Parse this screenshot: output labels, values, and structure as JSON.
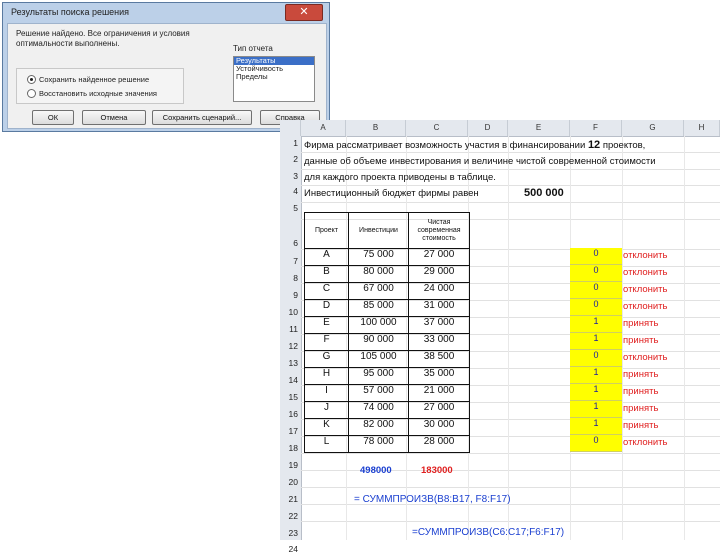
{
  "dialog": {
    "title": "Результаты поиска решения",
    "close_label": "✕",
    "message_line1": "Решение найдено. Все ограничения и условия",
    "message_line2": "оптимальности выполнены.",
    "reports_label": "Тип отчета",
    "reports": [
      "Результаты",
      "Устойчивость",
      "Пределы"
    ],
    "option_keep": "Сохранить найденное решение",
    "option_restore": "Восстановить исходные значения",
    "btn_ok": "ОК",
    "btn_cancel": "Отмена",
    "btn_save_scenario": "Сохранить сценарий...",
    "btn_help": "Справка"
  },
  "sheet": {
    "columns": [
      "A",
      "B",
      "C",
      "D",
      "E",
      "F",
      "G",
      "H"
    ],
    "rows": [
      "1",
      "2",
      "3",
      "4",
      "5",
      "6",
      "7",
      "8",
      "9",
      "10",
      "11",
      "12",
      "13",
      "14",
      "15",
      "16",
      "17",
      "18",
      "19",
      "20",
      "21",
      "22",
      "23",
      "24"
    ],
    "line1": "Фирма рассматривает возможность участия в финансировании",
    "line1_bold": "12",
    "line1_end": "проектов,",
    "line2": "данные об объеме инвестирования и величине чистой современной стоимости",
    "line3": "для каждого проекта приводены в таблице.",
    "budget_label": "Инвестиционный бюджет фирмы равен",
    "budget_value": "500 000",
    "table_headers": [
      "Проект",
      "Инвестиции",
      "Чистая современная стоимость"
    ],
    "projects": [
      {
        "name": "A",
        "invest": "75 000",
        "npv": "27 000",
        "x": "0",
        "decision": "отклонить"
      },
      {
        "name": "B",
        "invest": "80 000",
        "npv": "29 000",
        "x": "0",
        "decision": "отклонить"
      },
      {
        "name": "C",
        "invest": "67 000",
        "npv": "24 000",
        "x": "0",
        "decision": "отклонить"
      },
      {
        "name": "D",
        "invest": "85 000",
        "npv": "31 000",
        "x": "0",
        "decision": "отклонить"
      },
      {
        "name": "E",
        "invest": "100 000",
        "npv": "37 000",
        "x": "1",
        "decision": "принять"
      },
      {
        "name": "F",
        "invest": "90 000",
        "npv": "33 000",
        "x": "1",
        "decision": "принять"
      },
      {
        "name": "G",
        "invest": "105 000",
        "npv": "38 500",
        "x": "0",
        "decision": "отклонить"
      },
      {
        "name": "H",
        "invest": "95 000",
        "npv": "35 000",
        "x": "1",
        "decision": "принять"
      },
      {
        "name": "I",
        "invest": "57 000",
        "npv": "21 000",
        "x": "1",
        "decision": "принять"
      },
      {
        "name": "J",
        "invest": "74 000",
        "npv": "27 000",
        "x": "1",
        "decision": "принять"
      },
      {
        "name": "K",
        "invest": "82 000",
        "npv": "30 000",
        "x": "1",
        "decision": "принять"
      },
      {
        "name": "L",
        "invest": "78 000",
        "npv": "28 000",
        "x": "0",
        "decision": "отклонить"
      }
    ],
    "total_invest": "498000",
    "total_npv": "183000",
    "formula1": "= СУММПРОИЗВ(B8:B17, F8:F17)",
    "formula2": "=СУММПРОИЗВ(C6:C17;F6:F17)"
  }
}
